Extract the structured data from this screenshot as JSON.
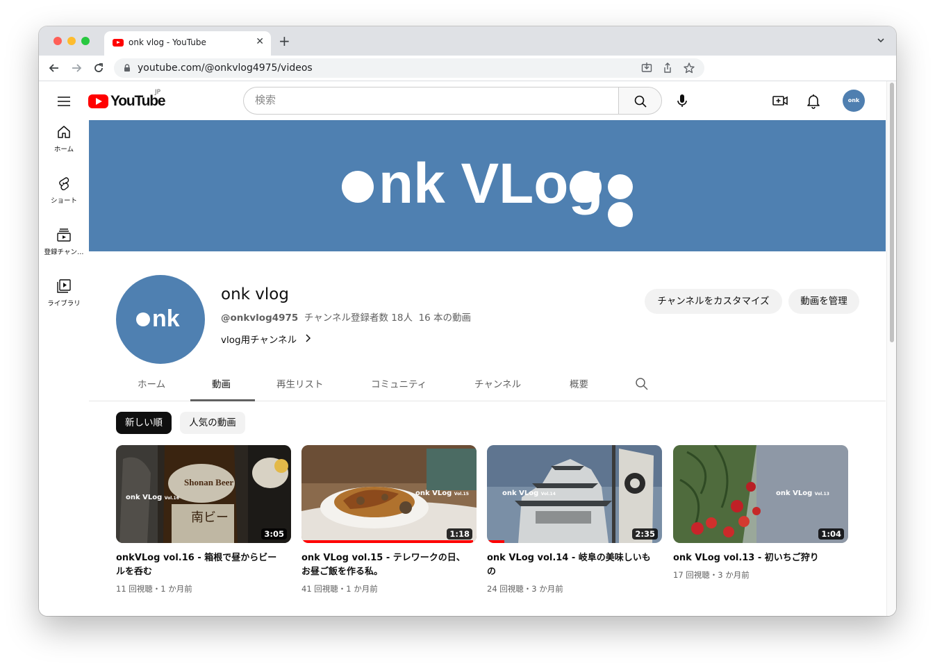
{
  "browser": {
    "tab_title": "onk vlog - YouTube",
    "new_tab": "+",
    "url": "youtube.com/@onkvlog4975/videos"
  },
  "youtube": {
    "wordmark": "YouTube",
    "region": "JP",
    "search_placeholder": "検索",
    "avatar_text": "onk"
  },
  "guide": {
    "items": [
      {
        "label": "ホーム",
        "icon": "home-icon"
      },
      {
        "label": "ショート",
        "icon": "shorts-icon"
      },
      {
        "label": "登録チャン…",
        "icon": "subscriptions-icon"
      },
      {
        "label": "ライブラリ",
        "icon": "library-icon"
      }
    ]
  },
  "banner": {
    "text": "onk VLog"
  },
  "channel": {
    "avatar_text": "onk",
    "name": "onk vlog",
    "handle": "@onkvlog4975",
    "subscribers": "チャンネル登録者数 18人",
    "video_count": "16 本の動画",
    "description": "vlog用チャンネル",
    "customize_label": "チャンネルをカスタマイズ",
    "manage_label": "動画を管理"
  },
  "tabs": [
    {
      "label": "ホーム"
    },
    {
      "label": "動画"
    },
    {
      "label": "再生リスト"
    },
    {
      "label": "コミュニティ"
    },
    {
      "label": "チャンネル"
    },
    {
      "label": "概要"
    }
  ],
  "active_tab": "動画",
  "sort_chips": [
    {
      "label": "新しい順",
      "active": true
    },
    {
      "label": "人気の動画",
      "active": false
    }
  ],
  "videos": [
    {
      "title": "onkVLog vol.16 - 箱根で昼からビールを呑む",
      "duration": "3:05",
      "views": "11 回視聴",
      "age": "1 か月前",
      "watched_fraction": 0,
      "logo": "onk VLog",
      "vol": "Vol.16"
    },
    {
      "title": "onk VLog vol.15 - テレワークの日、お昼ご飯を作る私。",
      "duration": "1:18",
      "views": "41 回視聴",
      "age": "1 か月前",
      "watched_fraction": 0.98,
      "logo": "onk VLog",
      "vol": "Vol.15"
    },
    {
      "title": "onk VLog vol.14 - 岐阜の美味しいもの",
      "duration": "2:35",
      "views": "24 回視聴",
      "age": "3 か月前",
      "watched_fraction": 0.1,
      "logo": "onk VLog",
      "vol": "Vol.14"
    },
    {
      "title": "onk VLog vol.13 - 初いちご狩り",
      "duration": "1:04",
      "views": "17 回視聴",
      "age": "3 か月前",
      "watched_fraction": 0,
      "logo": "onk VLog",
      "vol": "Vol.13"
    }
  ],
  "meta_separator": "・"
}
